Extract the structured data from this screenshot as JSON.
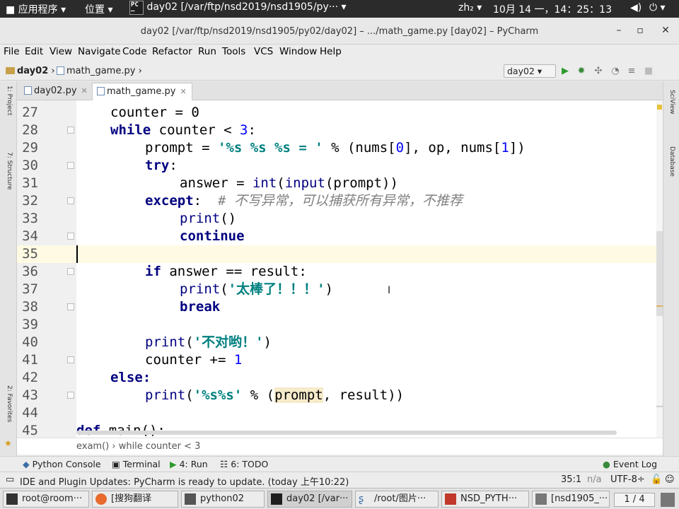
{
  "top_panel": {
    "apps_menu": "应用程序",
    "places_menu": "位置",
    "active_window": "day02 [/var/ftp/nsd2019/nsd1905/py···",
    "input_method": "zh₂",
    "clock": "10月 14 一，14：25：13"
  },
  "window": {
    "title": "day02 [/var/ftp/nsd2019/nsd1905/py02/day02] – .../math_game.py [day02] – PyCharm"
  },
  "menu": [
    "File",
    "Edit",
    "View",
    "Navigate",
    "Code",
    "Refactor",
    "Run",
    "Tools",
    "VCS",
    "Window",
    "Help"
  ],
  "nav": {
    "project": "day02",
    "file": "math_game.py",
    "run_config": "day02"
  },
  "tabs": [
    {
      "label": "day02.py",
      "active": false
    },
    {
      "label": "math_game.py",
      "active": true
    }
  ],
  "editor": {
    "lines": [
      {
        "n": "27",
        "text": "counter = 0"
      },
      {
        "n": "28",
        "text": "while counter < 3:"
      },
      {
        "n": "29",
        "text": "prompt = '%s %s %s = ' % (nums[0], op, nums[1])"
      },
      {
        "n": "30",
        "text": "try:"
      },
      {
        "n": "31",
        "text": "answer = int(input(prompt))"
      },
      {
        "n": "32",
        "text": "except:  # 不写异常，可以捕获所有异常，不推荐"
      },
      {
        "n": "33",
        "text": "print()"
      },
      {
        "n": "34",
        "text": "continue"
      },
      {
        "n": "35",
        "text": ""
      },
      {
        "n": "36",
        "text": "if answer == result:"
      },
      {
        "n": "37",
        "text": "print('太棒了！！！')"
      },
      {
        "n": "38",
        "text": "break"
      },
      {
        "n": "39",
        "text": ""
      },
      {
        "n": "40",
        "text": "print('不对哟！')"
      },
      {
        "n": "41",
        "text": "counter += 1"
      },
      {
        "n": "42",
        "text": "else:"
      },
      {
        "n": "43",
        "text": "print('%s%s' % (prompt, result))"
      },
      {
        "n": "44",
        "text": ""
      },
      {
        "n": "45",
        "text": "def main():"
      }
    ]
  },
  "code_breadcrumb": "exam()  ›  while counter < 3",
  "tool_windows": {
    "python_console": "Python Console",
    "terminal": "Terminal",
    "run": "4: Run",
    "todo": "6: TODO",
    "event_log": "Event Log"
  },
  "status": {
    "message": "IDE and Plugin Updates: PyCharm is ready to update. (today 上午10:22)",
    "position": "35:1",
    "na": "n/a",
    "encoding": "UTF-8÷"
  },
  "taskbar": {
    "items": [
      "root@room···",
      "[搜狗翻译",
      "python02",
      "day02 [/var···",
      "/root/图片···",
      "NSD_PYTH···",
      "[nsd1905_···"
    ],
    "workspace": "1 / 4"
  },
  "colors": {
    "keyword": "#000080",
    "string": "#008080",
    "number": "#0000ff",
    "comment": "#808080",
    "current_line": "#fffae3"
  }
}
